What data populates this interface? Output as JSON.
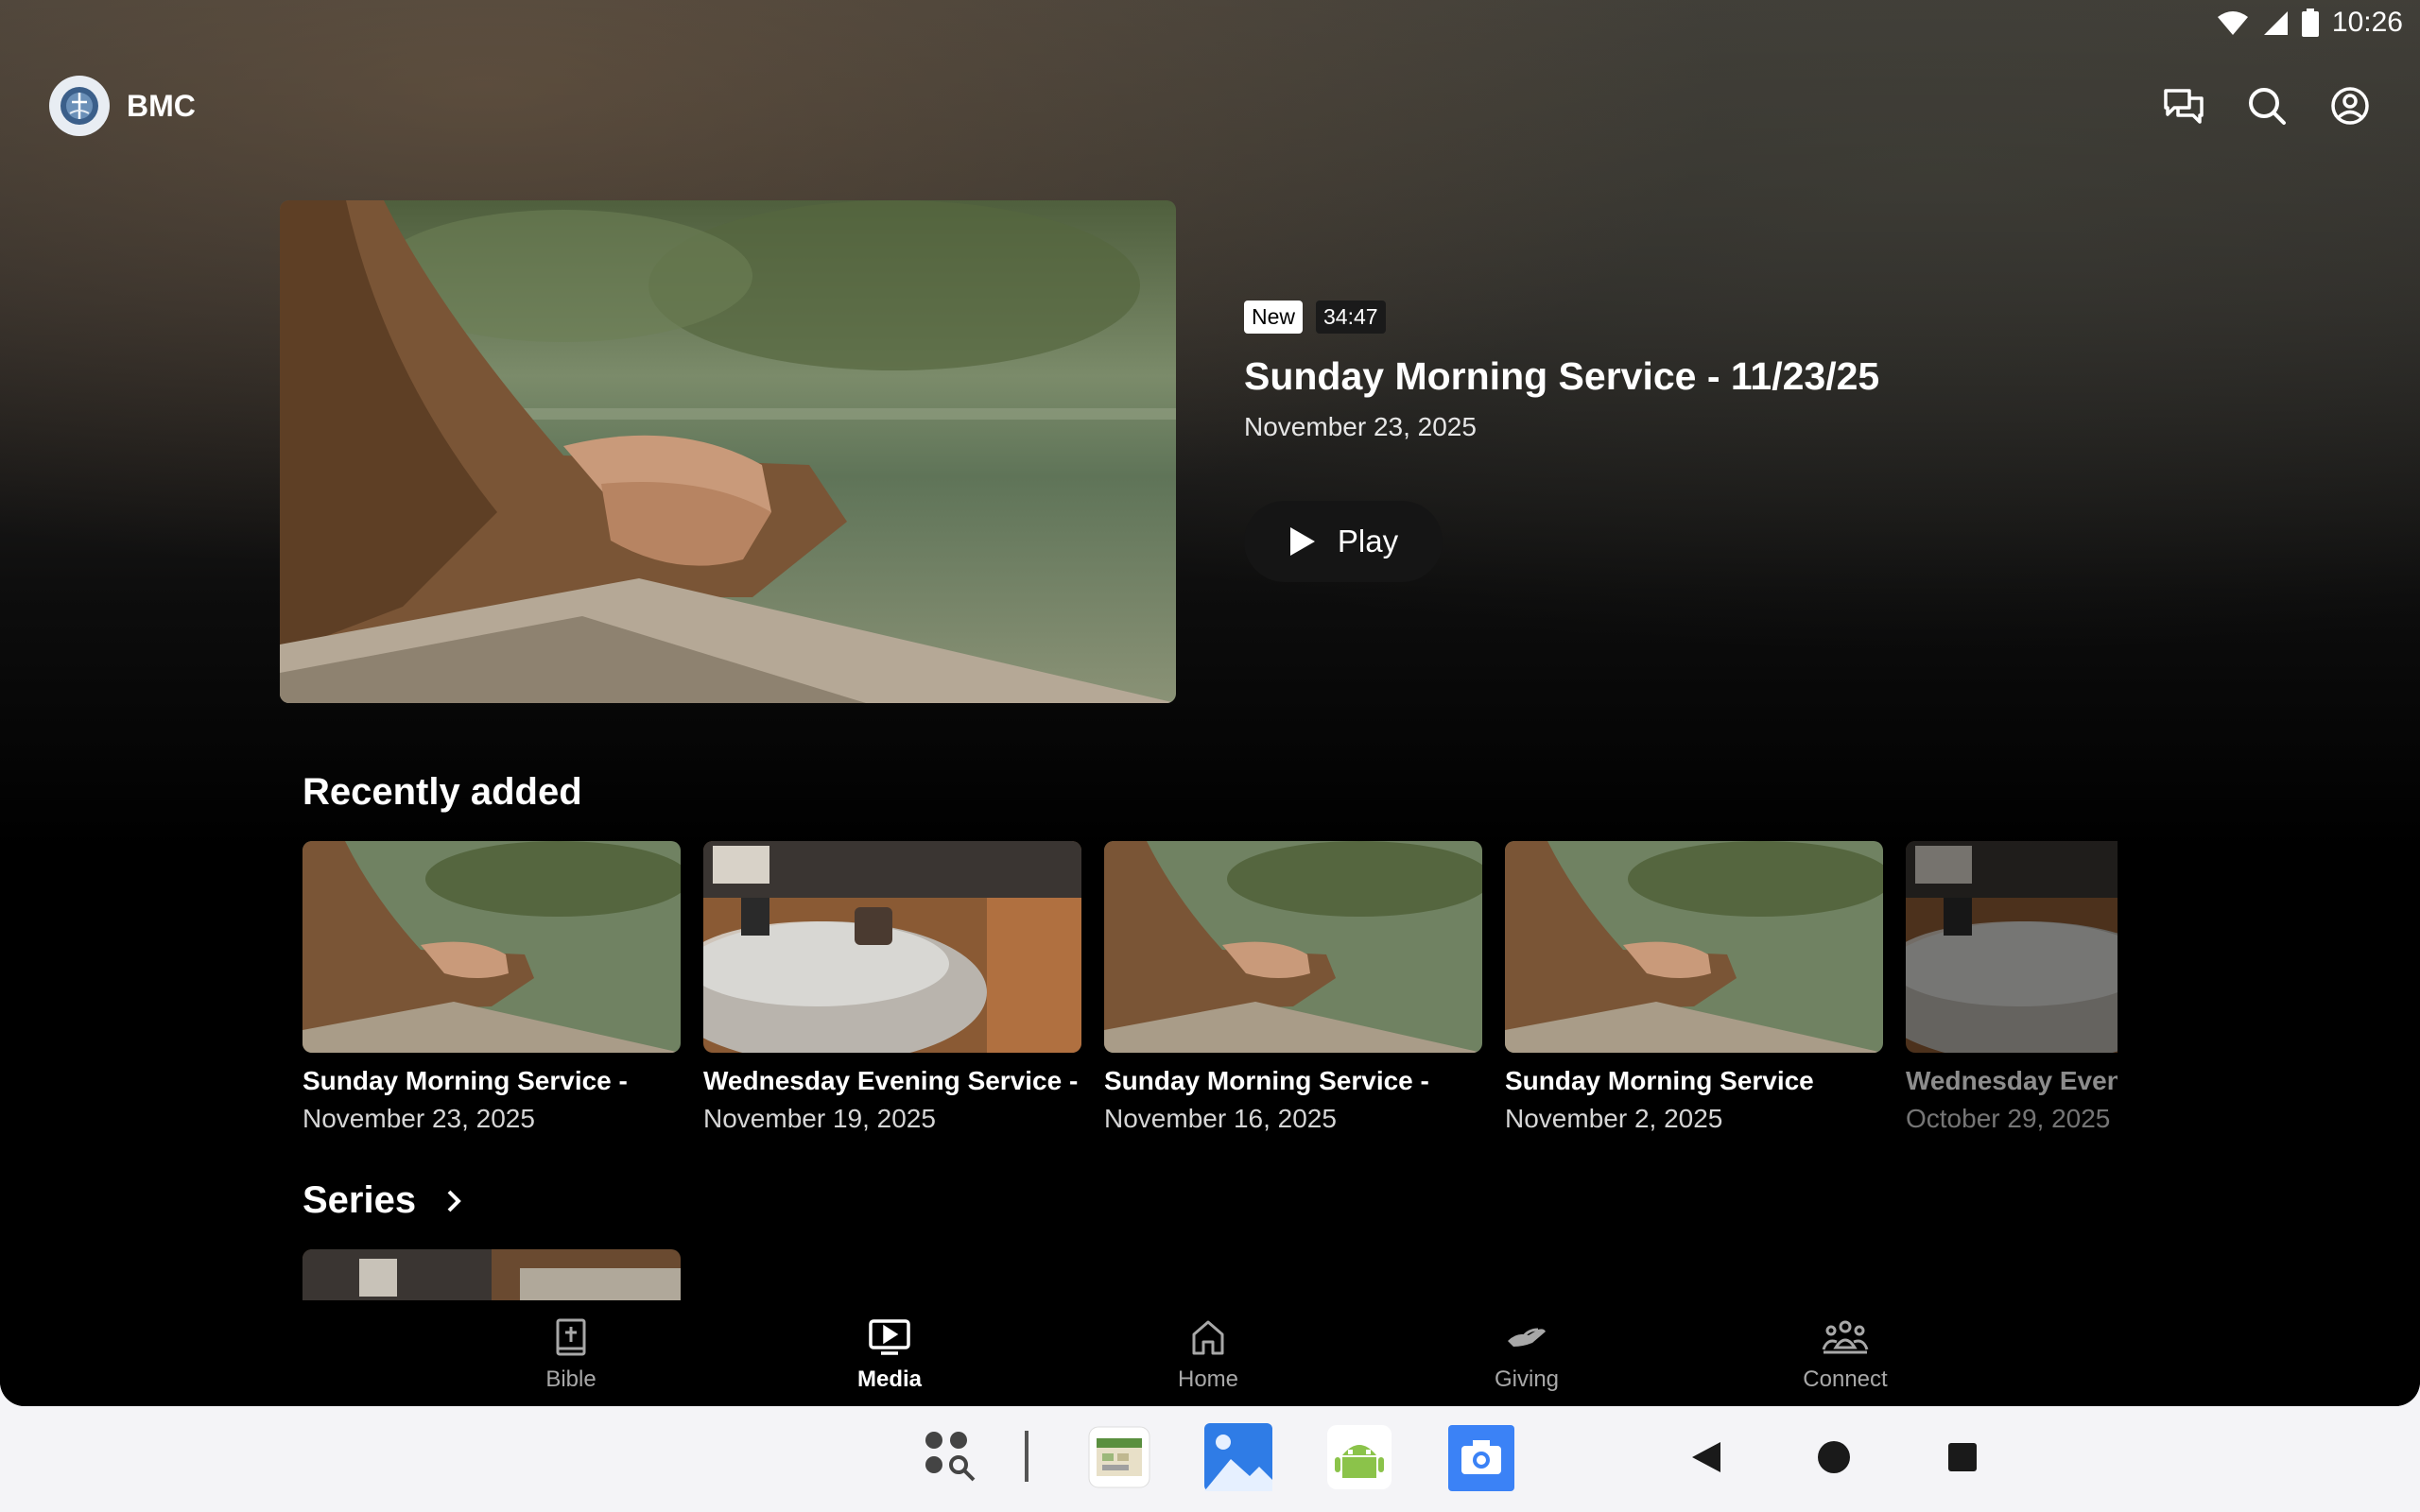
{
  "status_bar": {
    "time": "10:26"
  },
  "app": {
    "name": "BMC"
  },
  "header_icons": [
    "chat-icon",
    "search-icon",
    "account-icon"
  ],
  "featured": {
    "badge_new": "New",
    "duration": "34:47",
    "title": "Sunday Morning Service - 11/23/25",
    "date": "November 23, 2025",
    "play_label": "Play"
  },
  "recently_added": {
    "heading": "Recently added",
    "items": [
      {
        "title": "Sunday Morning Service -",
        "date": "November 23, 2025",
        "thumb": "forest"
      },
      {
        "title": "Wednesday Evening Service -",
        "date": "November 19, 2025",
        "thumb": "table"
      },
      {
        "title": "Sunday Morning Service -",
        "date": "November 16, 2025",
        "thumb": "forest"
      },
      {
        "title": "Sunday Morning Service",
        "date": "November 2, 2025",
        "thumb": "forest"
      },
      {
        "title": "Wednesday Even",
        "date": "October 29, 2025",
        "thumb": "table"
      }
    ]
  },
  "series": {
    "heading": "Series"
  },
  "bottom_nav": {
    "items": [
      {
        "label": "Bible",
        "icon": "bible-icon"
      },
      {
        "label": "Media",
        "icon": "media-icon",
        "active": true
      },
      {
        "label": "Home",
        "icon": "home-icon"
      },
      {
        "label": "Giving",
        "icon": "giving-icon"
      },
      {
        "label": "Connect",
        "icon": "connect-icon"
      }
    ]
  },
  "taskbar": {
    "apps": [
      "app-drawer-icon",
      "calendar-app-icon",
      "gallery-app-icon",
      "android-app-icon",
      "camera-app-icon"
    ],
    "nav": [
      "back-icon",
      "home-nav-icon",
      "recents-icon"
    ]
  }
}
